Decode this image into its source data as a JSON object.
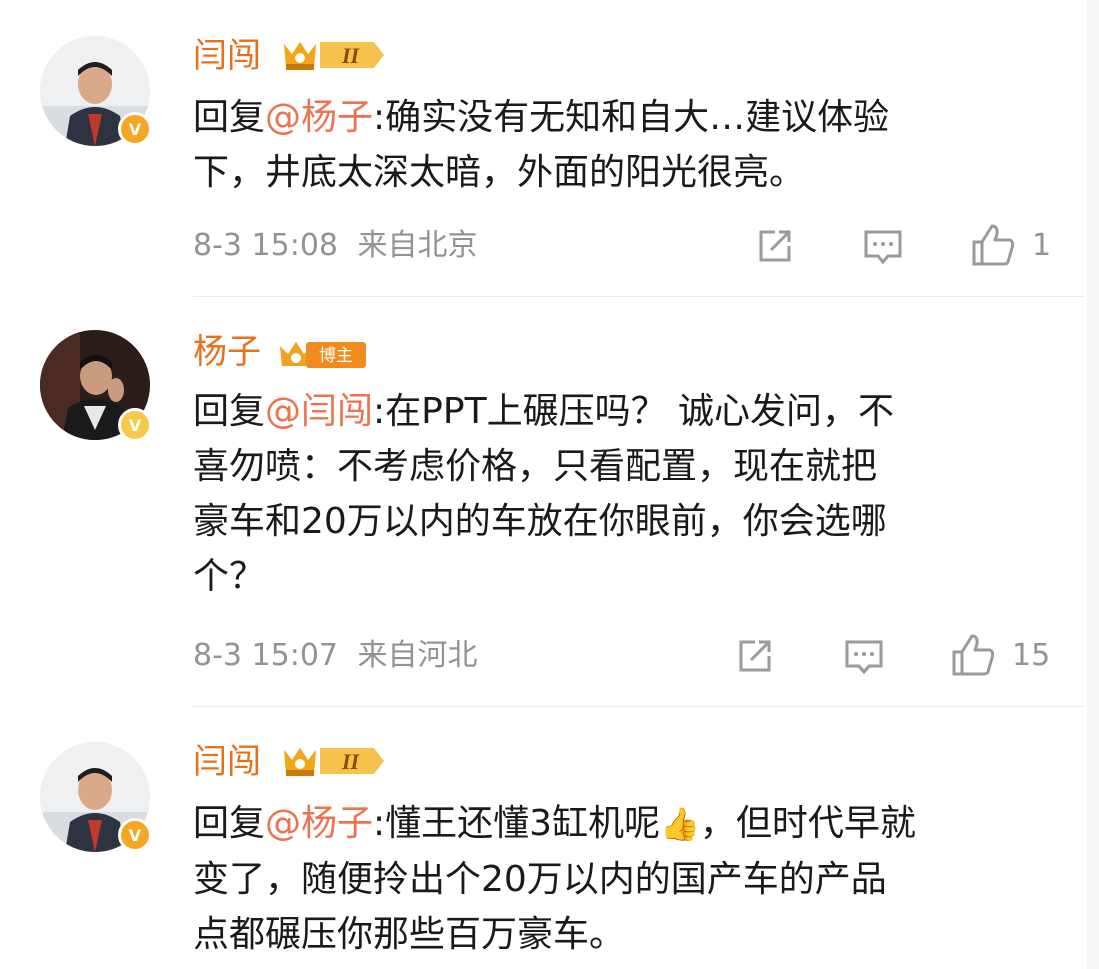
{
  "comments": [
    {
      "username": "闫闯",
      "level_badge": "II",
      "reply_prefix": "回复",
      "mention": "@杨子",
      "text": ":确实没有无知和自大…建议体验下，井底太深太暗，外面的阳光很亮。",
      "line1": ":确实没有无知和自大…建议体验",
      "line2": "下，井底太深太暗，外面的阳光很亮。",
      "date": "8-3 15:08",
      "location": "来自北京",
      "like_count": "1",
      "verified_color": "#f5a623"
    },
    {
      "username": "杨子",
      "level_badge": "博主",
      "reply_prefix": "回复",
      "mention": "@闫闯",
      "line1": ":在PPT上碾压吗？ 诚心发问，不",
      "line2": "喜勿喷：不考虑价格，只看配置，现在就把",
      "line3": "豪车和20万以内的车放在你眼前，你会选哪",
      "line4": "个？",
      "date": "8-3 15:07",
      "location": "来自河北",
      "like_count": "15",
      "verified_color": "#f7c948"
    },
    {
      "username": "闫闯",
      "level_badge": "II",
      "reply_prefix": "回复",
      "mention": "@杨子",
      "line1_a": ":懂王还懂3缸机呢",
      "line1_b": "，但时代早就",
      "line2": "变了，随便拎出个20万以内的国产车的产品",
      "line3": "点都碾压你那些百万豪车。",
      "verified_color": "#f5a623"
    }
  ],
  "icons": {
    "repost": "repost-icon",
    "comment": "comment-icon",
    "like": "thumbs-up-icon",
    "thumb_emoji": "👍"
  },
  "colors": {
    "username": "#e8701a",
    "mention": "#eb7350",
    "meta": "#939393"
  }
}
